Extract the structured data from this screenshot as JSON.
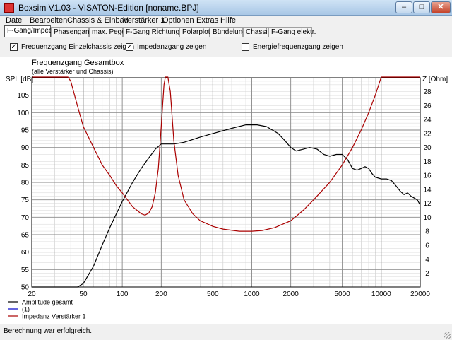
{
  "window": {
    "title": "Boxsim V1.03 - VISATON-Edition [noname.BPJ]",
    "minimize": "–",
    "maximize": "□",
    "close": "✕"
  },
  "menu": [
    "Datei",
    "Bearbeiten",
    "Chassis & Einbau",
    "Verstärker 1",
    "Optionen",
    "Extras",
    "Hilfe"
  ],
  "tabs": [
    "F-Gang/Imped.",
    "Phasengang",
    "max. Pegel",
    "F-Gang Richtungen",
    "Polarplots",
    "Bündelung",
    "Chassis",
    "F-Gang elektr."
  ],
  "options": [
    {
      "label": "Frequenzgang Einzelchassis zeigen",
      "checked": true
    },
    {
      "label": "Impedanzgang zeigen",
      "checked": true
    },
    {
      "label": "Energiefrequenzgang zeigen",
      "checked": false
    }
  ],
  "status": "Berechnung war erfolgreich.",
  "chart_data": {
    "type": "line",
    "title": "Frequenzgang Gesamtbox",
    "subtitle": "(alle Verstärker und Chassis)",
    "ylabel": "SPL [dB]",
    "y2label": "Z [Ohm]",
    "xscale": "log",
    "xlim": [
      20,
      20000
    ],
    "ylim": [
      50,
      110
    ],
    "y2lim": [
      0,
      30
    ],
    "x_ticks": [
      20,
      50,
      100,
      200,
      500,
      1000,
      2000,
      5000,
      10000,
      20000
    ],
    "y_ticks": [
      50,
      55,
      60,
      65,
      70,
      75,
      80,
      85,
      90,
      95,
      100,
      105
    ],
    "y2_ticks": [
      2,
      4,
      6,
      8,
      10,
      12,
      14,
      16,
      18,
      20,
      22,
      24,
      26,
      28
    ],
    "grid": true,
    "legend_position": "bottom-left",
    "series": [
      {
        "name": "Amplitude gesamt",
        "axis": "left",
        "color": "#000000",
        "points": [
          [
            20,
            50
          ],
          [
            45,
            50
          ],
          [
            50,
            51
          ],
          [
            60,
            56
          ],
          [
            70,
            62
          ],
          [
            80,
            67
          ],
          [
            90,
            71
          ],
          [
            100,
            74.5
          ],
          [
            120,
            80
          ],
          [
            140,
            84
          ],
          [
            160,
            87
          ],
          [
            180,
            89.5
          ],
          [
            200,
            91
          ],
          [
            250,
            91
          ],
          [
            300,
            91.5
          ],
          [
            400,
            93
          ],
          [
            500,
            94
          ],
          [
            700,
            95.5
          ],
          [
            900,
            96.5
          ],
          [
            1100,
            96.5
          ],
          [
            1300,
            96
          ],
          [
            1600,
            94
          ],
          [
            1800,
            92
          ],
          [
            2000,
            90
          ],
          [
            2200,
            89
          ],
          [
            2500,
            89.5
          ],
          [
            2800,
            90
          ],
          [
            3200,
            89.5
          ],
          [
            3600,
            88
          ],
          [
            4000,
            87.5
          ],
          [
            4500,
            88
          ],
          [
            5000,
            88
          ],
          [
            5500,
            86.5
          ],
          [
            6000,
            84
          ],
          [
            6500,
            83.5
          ],
          [
            7000,
            84
          ],
          [
            7500,
            84.5
          ],
          [
            8000,
            84
          ],
          [
            8500,
            82.5
          ],
          [
            9000,
            81.5
          ],
          [
            10000,
            81
          ],
          [
            11000,
            81
          ],
          [
            12000,
            80.5
          ],
          [
            13000,
            79
          ],
          [
            14000,
            77.5
          ],
          [
            15000,
            76.5
          ],
          [
            16000,
            77
          ],
          [
            17000,
            76
          ],
          [
            18000,
            75.5
          ],
          [
            19000,
            75
          ],
          [
            20000,
            73.5
          ]
        ]
      },
      {
        "name": "(1)",
        "axis": "left",
        "color": "#0000cc",
        "points": []
      },
      {
        "name": "Impedanz Verstärker 1",
        "axis": "right",
        "color": "#aa0000",
        "points": [
          [
            20,
            31
          ],
          [
            30,
            31
          ],
          [
            35,
            31
          ],
          [
            38,
            30.5
          ],
          [
            40,
            29.5
          ],
          [
            45,
            26
          ],
          [
            50,
            23
          ],
          [
            60,
            20
          ],
          [
            70,
            17.5
          ],
          [
            80,
            16
          ],
          [
            90,
            14.5
          ],
          [
            100,
            13.5
          ],
          [
            120,
            11.5
          ],
          [
            140,
            10.5
          ],
          [
            150,
            10.3
          ],
          [
            160,
            10.6
          ],
          [
            170,
            11.5
          ],
          [
            180,
            13.5
          ],
          [
            190,
            17
          ],
          [
            200,
            23
          ],
          [
            210,
            29
          ],
          [
            215,
            31
          ],
          [
            225,
            31
          ],
          [
            235,
            28
          ],
          [
            250,
            21
          ],
          [
            270,
            16
          ],
          [
            300,
            12.5
          ],
          [
            350,
            10.5
          ],
          [
            400,
            9.5
          ],
          [
            500,
            8.7
          ],
          [
            600,
            8.3
          ],
          [
            800,
            8
          ],
          [
            1000,
            8
          ],
          [
            1200,
            8.1
          ],
          [
            1500,
            8.5
          ],
          [
            2000,
            9.5
          ],
          [
            2500,
            11
          ],
          [
            3000,
            12.5
          ],
          [
            4000,
            15
          ],
          [
            5000,
            17.5
          ],
          [
            6000,
            20
          ],
          [
            7000,
            22.5
          ],
          [
            8000,
            25
          ],
          [
            9000,
            27.5
          ],
          [
            10000,
            30.5
          ],
          [
            10500,
            31
          ],
          [
            20000,
            31
          ]
        ]
      }
    ]
  }
}
